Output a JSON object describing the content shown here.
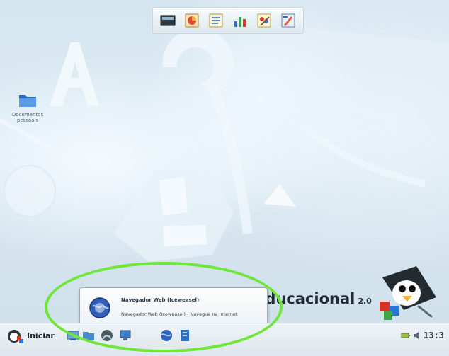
{
  "desktop": {
    "icon": {
      "name": "folder-icon",
      "label": "Documentos pessoais"
    }
  },
  "quick_launch": {
    "items": [
      {
        "name": "ql-terminal-button"
      },
      {
        "name": "ql-presentation-button"
      },
      {
        "name": "ql-writer-button"
      },
      {
        "name": "ql-chart-button"
      },
      {
        "name": "ql-paint-button"
      },
      {
        "name": "ql-draw-button"
      }
    ]
  },
  "branding": {
    "text": "Educacional",
    "version": "2.0"
  },
  "tooltip": {
    "title": "Navegador Web (Iceweasel)",
    "description": "Navegador Web (Iceweasel) - Navegue na Internet"
  },
  "taskbar": {
    "start_label": "Iniciar",
    "clock": "13:3"
  },
  "colors": {
    "highlight": "#6ee63a",
    "desktop_bg": "#d6e6f0"
  }
}
